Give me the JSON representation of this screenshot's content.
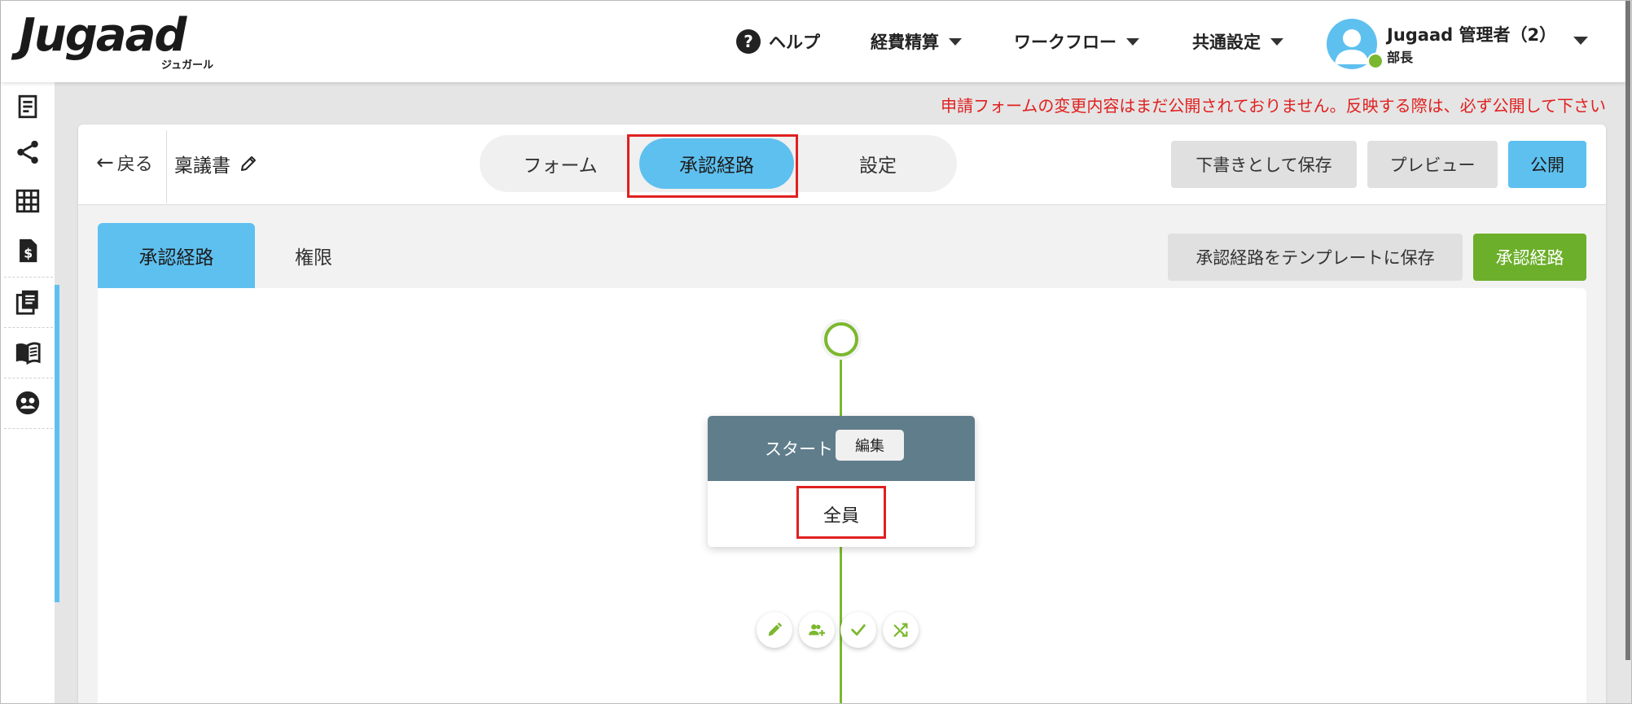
{
  "app": {
    "logo": "Jugaad",
    "logo_sub": "ジュガール"
  },
  "header": {
    "help": "ヘルプ",
    "menus": [
      "経費精算",
      "ワークフロー",
      "共通設定"
    ],
    "user_name": "Jugaad 管理者（2）",
    "user_role": "部長"
  },
  "notice": "申請フォームの変更内容はまだ公開されておりません。反映する際は、必ず公開して下さい",
  "topbar": {
    "back": "戻る",
    "doc_title": "稟議書",
    "segments": [
      "フォーム",
      "承認経路",
      "設定"
    ],
    "active_segment": "承認経路",
    "save_draft": "下書きとして保存",
    "preview": "プレビュー",
    "publish": "公開"
  },
  "subtabs": {
    "items": [
      "承認経路",
      "権限"
    ],
    "active": "承認経路",
    "save_template": "承認経路をテンプレートに保存",
    "route": "承認経路"
  },
  "flow": {
    "node_title": "スタート",
    "node_edit": "編集",
    "node_value": "全員"
  },
  "colors": {
    "accent_blue": "#5ec0ef",
    "accent_green": "#6caf2a",
    "flow_green": "#7cb82f",
    "node_header": "#607d8b",
    "warning_red": "#e02020"
  }
}
